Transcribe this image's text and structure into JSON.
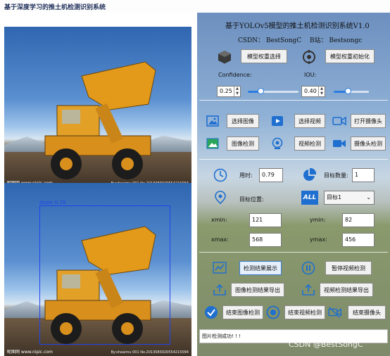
{
  "window": {
    "title": "基于深度学习的推土机检测识别系统"
  },
  "left": {
    "watermark": "昵图网 www.nipic.com",
    "watermark_small": "By:sheaimu 001 No.2013083020554215094",
    "detection_label": "dozer 0.78"
  },
  "header": {
    "title": "基于YOLOv5模型的推土机检测识别系统V1.0",
    "csdn": "CSDN： BestSongC",
    "bili": "B站： Bestsongc"
  },
  "model": {
    "select_label": "模型权重选择",
    "init_label": "模型权重初始化"
  },
  "params": {
    "confidence_label": "Confidence:",
    "confidence_value": "0.25",
    "confidence_level": 0.25,
    "iou_label": "IOU:",
    "iou_value": "0.40",
    "iou_level": 0.4
  },
  "actions": {
    "select_image": "选择图像",
    "select_video": "选择视频",
    "open_camera": "打开摄像头",
    "detect_image": "图像检测",
    "detect_video": "视频检测",
    "detect_camera": "摄像头检测"
  },
  "results": {
    "time_label": "用时:",
    "time_value": "0.79",
    "count_label": "目标数量:",
    "count_value": "1",
    "position_label": "目标位置:",
    "target_select": "目标1",
    "xmin_label": "xmin:",
    "xmin_value": "121",
    "ymin_label": "ymin:",
    "ymin_value": "82",
    "xmax_label": "xmax:",
    "xmax_value": "568",
    "ymax_label": "ymax:",
    "ymax_value": "456"
  },
  "bottom": {
    "show_results": "检测结果展示",
    "pause_video": "暂停视频检测",
    "export_image": "图像检测结果导出",
    "export_video": "视频检测结果导出",
    "end_image": "结束图像检测",
    "end_video": "结束视频检测",
    "end_camera": "结束摄像头"
  },
  "status": {
    "message": "图片检测成功! ! !"
  },
  "footer": {
    "watermark": "CSDN @BestSongC"
  },
  "colors": {
    "accent": "#2a7de1",
    "box": "#2244ee"
  }
}
